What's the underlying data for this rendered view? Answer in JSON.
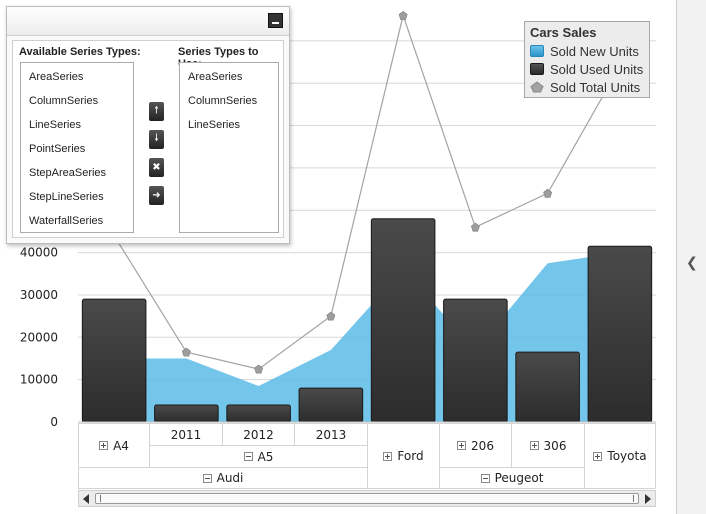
{
  "chart_data": {
    "type": "bar",
    "title": "",
    "ylim": [
      0,
      95000
    ],
    "yticks": [
      0,
      10000,
      20000,
      30000,
      40000
    ],
    "grid": true,
    "categories": [
      "A4",
      "A5 2011",
      "A5 2012",
      "A5 2013",
      "Ford",
      "206",
      "306",
      "Toyota"
    ],
    "series": [
      {
        "name": "Sold New Units",
        "kind": "area",
        "color": "#5bbbe6",
        "values": [
          15000,
          15000,
          8500,
          17000,
          36000,
          17000,
          37500,
          40000
        ]
      },
      {
        "name": "Sold Used Units",
        "kind": "column",
        "color": "#333333",
        "values": [
          29000,
          4000,
          4000,
          8000,
          48000,
          29000,
          16500,
          41500
        ]
      },
      {
        "name": "Sold Total Units",
        "kind": "line",
        "color": "#a3a3a3",
        "values": [
          44000,
          16500,
          12500,
          25000,
          96000,
          46000,
          54000,
          84000
        ]
      }
    ],
    "legend": {
      "title": "Cars Sales",
      "placement": "top-right"
    },
    "x_axis_groups": {
      "level1": [
        "A4",
        "2011",
        "2012",
        "2013",
        "206",
        "306"
      ],
      "level2": [
        "A5"
      ],
      "level3": [
        "Audi",
        "Ford",
        "Peugeot",
        "Toyota"
      ]
    }
  },
  "editor": {
    "available_label": "Available Series Types:",
    "use_label": "Series Types to Use:",
    "available": [
      "AreaSeries",
      "ColumnSeries",
      "LineSeries",
      "PointSeries",
      "StepAreaSeries",
      "StepLineSeries",
      "WaterfallSeries"
    ],
    "in_use": [
      "AreaSeries",
      "ColumnSeries",
      "LineSeries"
    ],
    "buttons": [
      "move-up-icon",
      "move-down-icon",
      "remove-icon",
      "add-icon"
    ]
  },
  "colors": {
    "new": "#5bbbe6",
    "used": "#333333",
    "total": "#a3a3a3",
    "grid": "#d8d8d8"
  }
}
